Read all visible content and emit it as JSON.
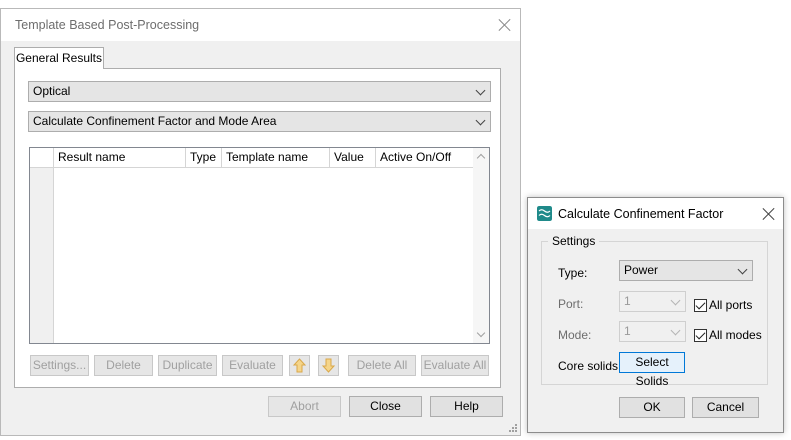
{
  "main_window": {
    "title": "Template Based Post-Processing",
    "tab": "General Results",
    "combo_category": "Optical",
    "combo_template": "Calculate Confinement Factor and Mode Area",
    "table_headers": [
      "Result name",
      "Type",
      "Template name",
      "Value",
      "Active On/Off"
    ],
    "buttons": {
      "settings": "Settings...",
      "delete": "Delete",
      "duplicate": "Duplicate",
      "evaluate": "Evaluate",
      "delete_all": "Delete All",
      "evaluate_all": "Evaluate All",
      "abort": "Abort",
      "close": "Close",
      "help": "Help"
    },
    "icons": {
      "move_up": "arrow-up-icon",
      "move_down": "arrow-down-icon",
      "accent": "#f0c040"
    }
  },
  "confinement_dialog": {
    "title": "Calculate Confinement Factor",
    "group_label": "Settings",
    "type_label": "Type:",
    "type_value": "Power",
    "port_label": "Port:",
    "port_value": "1",
    "all_ports_label": "All ports",
    "mode_label": "Mode:",
    "mode_value": "1",
    "all_modes_label": "All modes",
    "core_solids_label": "Core solids:",
    "select_solids_button": "Select Solids",
    "ok": "OK",
    "cancel": "Cancel"
  }
}
